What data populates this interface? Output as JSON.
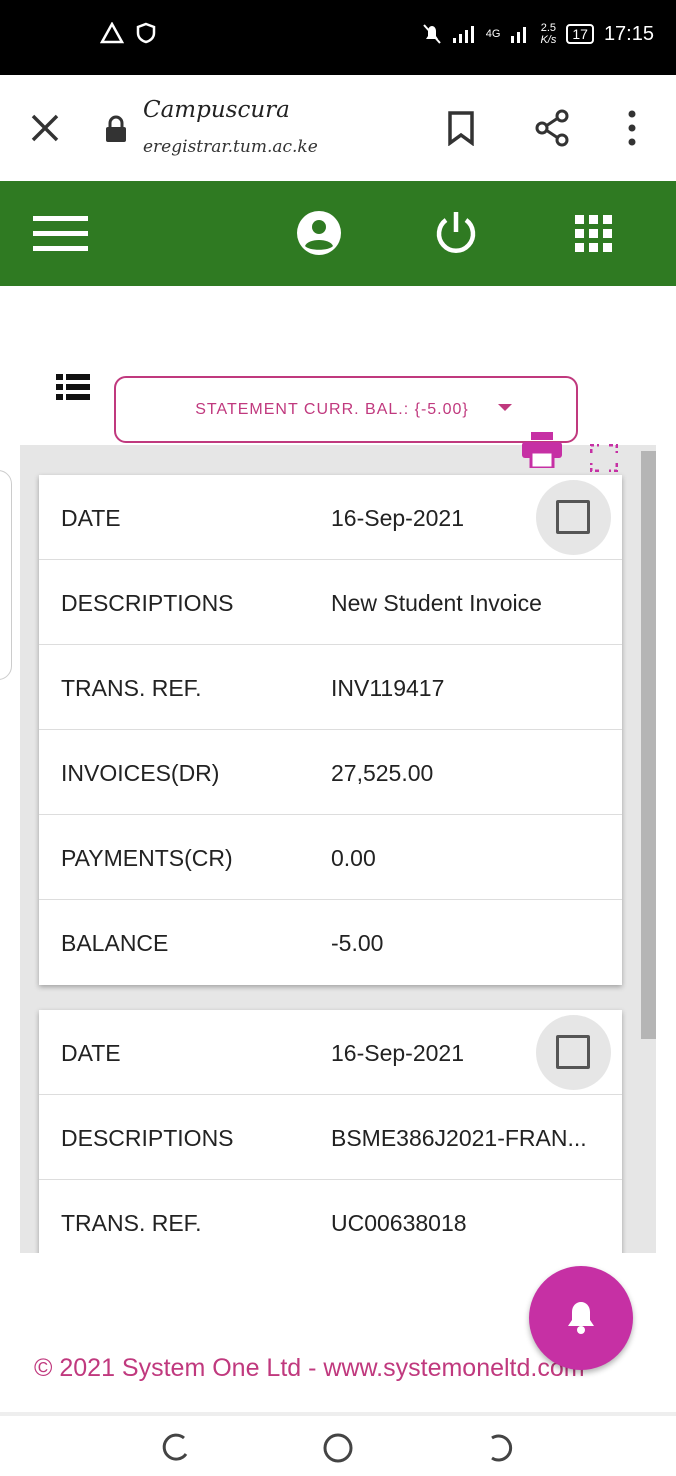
{
  "status_bar": {
    "time": "17:15",
    "battery": "17",
    "net_speed_top": "2.5",
    "net_speed_bottom": "K/s",
    "network": "4G"
  },
  "browser": {
    "title": "Campuscura",
    "url": "eregistrar.tum.ac.ke"
  },
  "statement": {
    "label": "STATEMENT CURR. BAL.: {-5.00}"
  },
  "cards": [
    {
      "rows": [
        {
          "label": "DATE",
          "value": "16-Sep-2021"
        },
        {
          "label": "DESCRIPTIONS",
          "value": "New Student Invoice"
        },
        {
          "label": "TRANS. REF.",
          "value": "INV119417"
        },
        {
          "label": "INVOICES(DR)",
          "value": "27,525.00"
        },
        {
          "label": "PAYMENTS(CR)",
          "value": "0.00"
        },
        {
          "label": "BALANCE",
          "value": "-5.00"
        }
      ]
    },
    {
      "rows": [
        {
          "label": "DATE",
          "value": "16-Sep-2021"
        },
        {
          "label": "DESCRIPTIONS",
          "value": "BSME386J2021-FRAN..."
        },
        {
          "label": "TRANS. REF.",
          "value": "UC00638018"
        }
      ]
    }
  ],
  "footer": {
    "text": "© 2021 System One Ltd - www.systemoneltd.com"
  },
  "colors": {
    "header_green": "#2f7a22",
    "accent_magenta": "#c0397e",
    "fab": "#c630a4"
  }
}
